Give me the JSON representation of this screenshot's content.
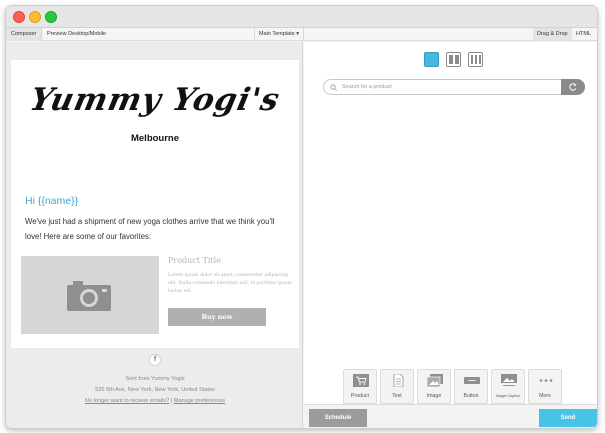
{
  "toolbar": {
    "tab_composer": "Composer",
    "tab_preview": "Preview Desktop/Mobile",
    "template_dropdown": "Main Template",
    "tab_drag_drop": "Drag & Drop",
    "tab_html": "HTML"
  },
  "email": {
    "logo_text": "Yummy Yogi's",
    "subtitle": "Melbourne",
    "greeting": "Hi {{name}}",
    "paragraph": "We've just had a shipment of new yoga clothes arrive that we think you'll love! Here are some of our favorites:",
    "product": {
      "title": "Product Title",
      "description": "Lorem ipsum dolor sit amet, consectetur adipiscing elit. Nulla commodo interdum nisl, id porttitor ipsum luctus vel.",
      "button": "Buy now"
    },
    "footer": {
      "social": "f",
      "sent_from": "Sent from Yummy Yogis",
      "address": "525 6th Ave, New York, New York, United States",
      "unsubscribe": "No longer want to recieve emails?",
      "separator": " | ",
      "manage": "Manage preferences"
    }
  },
  "builder": {
    "search_placeholder": "Search for a product",
    "blocks": [
      {
        "label": "Product",
        "icon": "cart-icon"
      },
      {
        "label": "Text",
        "icon": "document-icon"
      },
      {
        "label": "Image",
        "icon": "image-icon"
      },
      {
        "label": "Button",
        "icon": "button-icon"
      },
      {
        "label": "Image+Caption",
        "icon": "image-caption-icon"
      },
      {
        "label": "More",
        "icon": "more-icon"
      }
    ]
  },
  "actions": {
    "schedule": "Schedule",
    "send": "Send"
  },
  "colors": {
    "accent": "#47b6e0",
    "send": "#47c3e3",
    "greeting": "#3aa9d8"
  }
}
